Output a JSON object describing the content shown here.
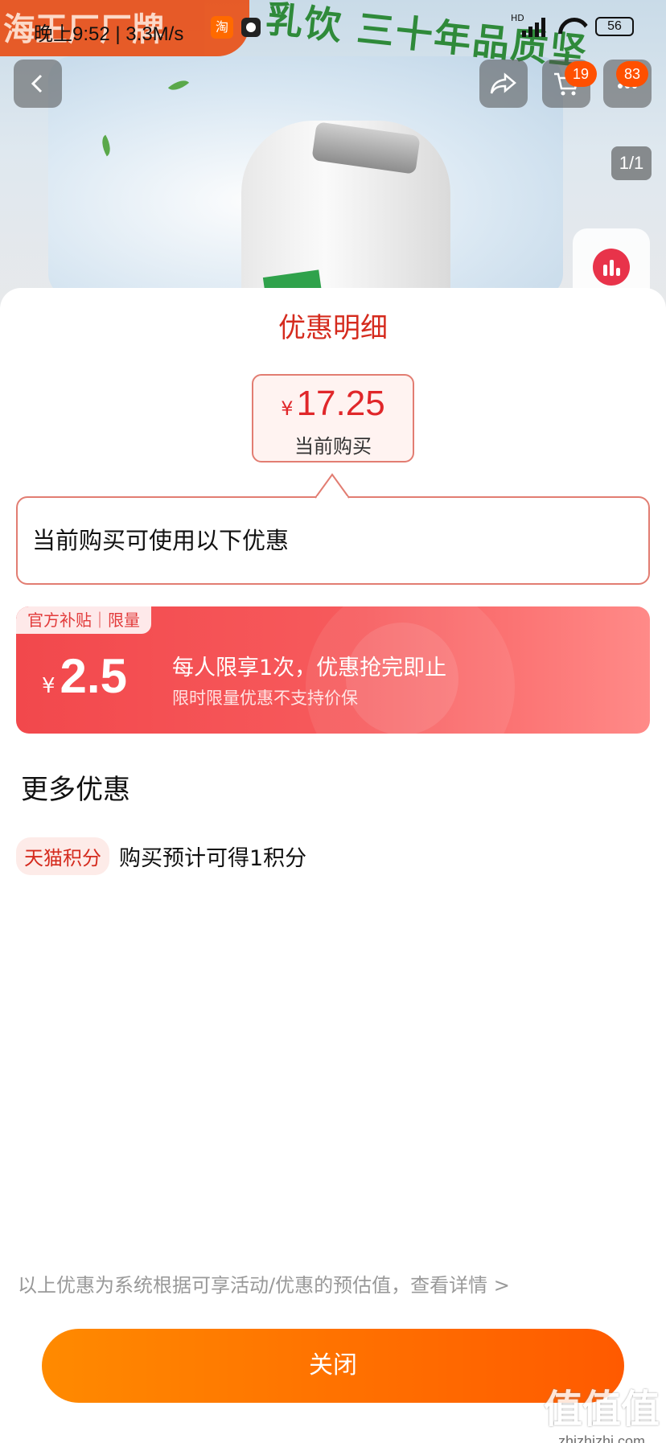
{
  "status_bar": {
    "time": "晚上9:52",
    "speed": "3.3M/s",
    "app_icon_text": "淘",
    "signal_label": "HD",
    "battery": "56"
  },
  "background": {
    "banner_text": "海王厂厂牌",
    "slogan": "乳饮 三十年品质坚"
  },
  "nav": {
    "cart_badge": "19",
    "more_badge": "83",
    "pager": "1/1"
  },
  "sheet": {
    "title": "优惠明细",
    "price": {
      "currency": "¥",
      "value": "17.25",
      "label": "当前购买"
    },
    "tip": "当前购买可使用以下优惠",
    "coupon": {
      "tag": "官方补贴｜限量",
      "currency": "¥",
      "amount": "2.5",
      "main_text": "每人限享1次，优惠抢完即止",
      "sub_text": "限时限量优惠不支持价保"
    },
    "more_title": "更多优惠",
    "points": {
      "tag": "天猫积分",
      "text": "购买预计可得1积分"
    },
    "footnote": "以上优惠为系统根据可享活动/优惠的预估值，查看详情 >",
    "close_label": "关闭"
  },
  "watermark": {
    "logo": "值值值",
    "url": "zhizhizhi.com"
  },
  "colors": {
    "accent_red": "#d52b1e",
    "coupon_red": "#f2484c",
    "button_orange": "#ff6a00"
  }
}
